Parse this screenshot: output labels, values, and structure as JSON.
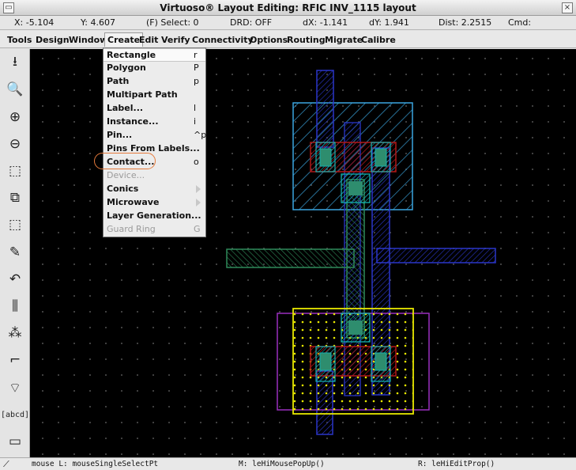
{
  "window": {
    "title": "Virtuoso® Layout Editing: RFIC INV_1115 layout",
    "menu_icon": "window-menu-icon",
    "close_icon": "close-icon"
  },
  "status": {
    "x": "X: -5.104",
    "y": "Y: 4.607",
    "select": "(F) Select: 0",
    "drd": "DRD: OFF",
    "dx": "dX: -1.141",
    "dy": "dY: 1.941",
    "dist": "Dist: 2.2515",
    "cmd": "Cmd:"
  },
  "menubar": [
    "Tools",
    "Design",
    "Window",
    "Create",
    "Edit",
    "Verify",
    "Connectivity",
    "Options",
    "Routing",
    "Migrate",
    "Calibre"
  ],
  "toolbar": [
    {
      "icon": "save-icon",
      "glyph": "⭳"
    },
    {
      "icon": "fit-view-icon",
      "glyph": "🔍"
    },
    {
      "icon": "zoom-in-icon",
      "glyph": "⊕"
    },
    {
      "icon": "zoom-out-icon",
      "glyph": "⊖"
    },
    {
      "icon": "stretch-icon",
      "glyph": "⬚"
    },
    {
      "icon": "copy-icon",
      "glyph": "⧉"
    },
    {
      "icon": "move-icon",
      "glyph": "⬚"
    },
    {
      "icon": "delete-icon",
      "glyph": "✎"
    },
    {
      "icon": "undo-icon",
      "glyph": "↶"
    },
    {
      "icon": "properties-icon",
      "glyph": "⫼"
    },
    {
      "icon": "hierarchy-icon",
      "glyph": "⁂"
    },
    {
      "icon": "path-icon",
      "glyph": "⌐"
    },
    {
      "icon": "polygon-icon",
      "glyph": "⌔"
    },
    {
      "icon": "label-icon",
      "glyph": "[abcd]"
    },
    {
      "icon": "instance-icon",
      "glyph": "▭"
    }
  ],
  "create_menu": [
    {
      "label": "Rectangle",
      "key": "r",
      "state": "highlighted"
    },
    {
      "label": "Polygon",
      "key": "P",
      "state": "enabled"
    },
    {
      "label": "Path",
      "key": "p",
      "state": "enabled"
    },
    {
      "label": "Multipart Path",
      "key": "",
      "state": "enabled"
    },
    {
      "label": "Label...",
      "key": "l",
      "state": "enabled"
    },
    {
      "label": "Instance...",
      "key": "i",
      "state": "enabled"
    },
    {
      "label": "Pin...",
      "key": "^p",
      "state": "enabled"
    },
    {
      "label": "Pins From Labels...",
      "key": "",
      "state": "enabled"
    },
    {
      "label": "Contact...",
      "key": "o",
      "state": "circled"
    },
    {
      "label": "Device...",
      "key": "",
      "state": "disabled"
    },
    {
      "label": "Conics",
      "key": "",
      "state": "submenu"
    },
    {
      "label": "Microwave",
      "key": "",
      "state": "submenu"
    },
    {
      "label": "Layer Generation...",
      "key": "",
      "state": "enabled"
    },
    {
      "label": "Guard Ring",
      "key": "G",
      "state": "disabled"
    }
  ],
  "command_line": {
    "left": "mouse L: mouseSingleSelectPt",
    "middle": "M: leHiMousePopUp()",
    "right": "R: leHiEditProp()"
  },
  "colors": {
    "canvas": "#000000",
    "nwell": "#3aa6e0",
    "metal1": "#2a36c9",
    "poly": "#2f8a5a",
    "diffusion": "#b01818",
    "contact": "#14b0b0",
    "implant": "#e8e800",
    "well": "#9b2fc0",
    "highlight_ring": "#e47a3c"
  }
}
